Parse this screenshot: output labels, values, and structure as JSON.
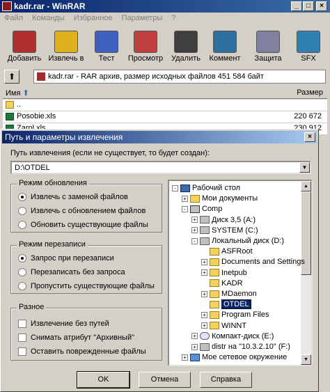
{
  "window": {
    "title": "kadr.rar - WinRAR",
    "min": "_",
    "max": "□",
    "close": "×"
  },
  "menu": [
    "Файл",
    "Команды",
    "Избранное",
    "Параметры",
    "?"
  ],
  "toolbar": [
    {
      "label": "Добавить",
      "icon": "add-books-icon",
      "color": "#b03030"
    },
    {
      "label": "Извлечь в",
      "icon": "extract-folder-icon",
      "color": "#e0b020"
    },
    {
      "label": "Тест",
      "icon": "test-icon",
      "color": "#4060c0"
    },
    {
      "label": "Просмотр",
      "icon": "view-book-icon",
      "color": "#c04040"
    },
    {
      "label": "Удалить",
      "icon": "delete-icon",
      "color": "#404040"
    },
    {
      "label": "Коммент",
      "icon": "comment-icon",
      "color": "#3070a0"
    },
    {
      "label": "Защита",
      "icon": "protect-icon",
      "color": "#8080a0"
    },
    {
      "label": "SFX",
      "icon": "sfx-icon",
      "color": "#3080b0"
    }
  ],
  "address": {
    "text": "kadr.rar - RAR архив, размер исходных файлов 451 584 байт"
  },
  "filelist": {
    "col_name": "Имя",
    "col_size": "Размер",
    "rows": [
      {
        "name": "..",
        "size": "",
        "type": "folder"
      },
      {
        "name": "Posobie.xls",
        "size": "220 672",
        "type": "xls"
      },
      {
        "name": "Zarpl.xls",
        "size": "230 912",
        "type": "xls"
      }
    ]
  },
  "dialog": {
    "title": "Путь и параметры извлечения",
    "close": "×",
    "path_label": "Путь извлечения (если не существует, то будет создан):",
    "path_value": "D:\\OTDEL",
    "update_group": {
      "title": "Режим обновления",
      "options": [
        "Извлечь с заменой файлов",
        "Извлечь с обновлением файлов",
        "Обновить существующие файлы"
      ],
      "selected": 0
    },
    "overwrite_group": {
      "title": "Режим перезаписи",
      "options": [
        "Запрос при перезаписи",
        "Перезаписать без запроса",
        "Пропустить существующие файлы"
      ],
      "selected": 0
    },
    "misc_group": {
      "title": "Разное",
      "options": [
        "Извлечение без путей",
        "Снимать атрибут \"Архивный\"",
        "Оставить поврежденные файлы"
      ]
    },
    "tree": [
      {
        "label": "Рабочий стол",
        "icon": "desktop-icon",
        "level": 0,
        "pm": "-"
      },
      {
        "label": "Мои документы",
        "icon": "folder-icon",
        "level": 1,
        "pm": "+"
      },
      {
        "label": "Comp",
        "icon": "computer-icon",
        "level": 1,
        "pm": "-"
      },
      {
        "label": "Диск 3,5 (A:)",
        "icon": "floppy-icon",
        "level": 2,
        "pm": "+"
      },
      {
        "label": "SYSTEM (C:)",
        "icon": "drive-icon",
        "level": 2,
        "pm": "+"
      },
      {
        "label": "Локальный диск (D:)",
        "icon": "drive-icon",
        "level": 2,
        "pm": "-"
      },
      {
        "label": "ASFRoot",
        "icon": "folder-icon",
        "level": 3,
        "pm": ""
      },
      {
        "label": "Documents and Settings",
        "icon": "folder-icon",
        "level": 3,
        "pm": "+"
      },
      {
        "label": "Inetpub",
        "icon": "folder-icon",
        "level": 3,
        "pm": "+"
      },
      {
        "label": "KADR",
        "icon": "folder-icon",
        "level": 3,
        "pm": ""
      },
      {
        "label": "MDaemon",
        "icon": "folder-icon",
        "level": 3,
        "pm": "+"
      },
      {
        "label": "OTDEL",
        "icon": "folder-open-icon",
        "level": 3,
        "pm": "",
        "selected": true
      },
      {
        "label": "Program Files",
        "icon": "folder-icon",
        "level": 3,
        "pm": "+"
      },
      {
        "label": "WINNT",
        "icon": "folder-icon",
        "level": 3,
        "pm": "+"
      },
      {
        "label": "Компакт-диск (E:)",
        "icon": "cd-icon",
        "level": 2,
        "pm": "+"
      },
      {
        "label": "distr на \"10.3.2.10\" (F:)",
        "icon": "network-drive-icon",
        "level": 2,
        "pm": "+"
      },
      {
        "label": "Мое сетевое окружение",
        "icon": "network-icon",
        "level": 1,
        "pm": "+"
      }
    ],
    "buttons": {
      "ok": "OK",
      "cancel": "Отмена",
      "help": "Справка"
    }
  }
}
